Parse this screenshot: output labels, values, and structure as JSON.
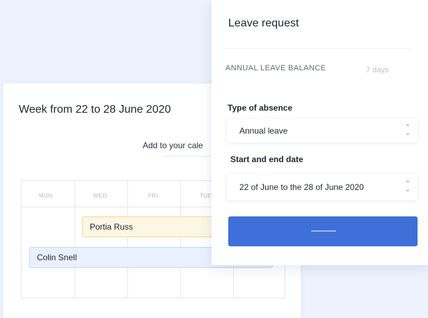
{
  "calendar": {
    "title": "Week from 22 to 28 June 2020",
    "add_label": "Add to your cale",
    "days": [
      "MON.",
      "WED.",
      "FRI.",
      "TUE."
    ],
    "events": [
      {
        "name": "Portia Russ",
        "color": "#fdf6e4"
      },
      {
        "name": "Colin Snell",
        "color": "#eaf0fd"
      }
    ]
  },
  "leave_request": {
    "title": "Leave request",
    "balance_label": "ANNUAL LEAVE BALANCE",
    "balance_value": "7 days",
    "type_label": "Type of absence",
    "type_value": "Annual leave",
    "date_label": "Start and end date",
    "date_value": "22 of June to the 28 of June 2020",
    "submit_color": "#3f6fd9"
  }
}
